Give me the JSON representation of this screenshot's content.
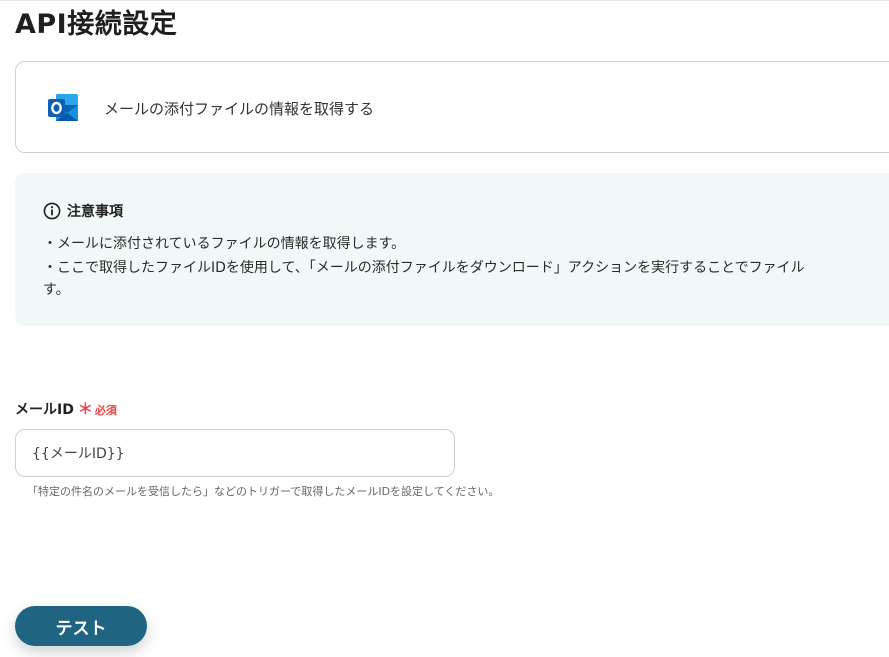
{
  "page": {
    "title": "API接続設定"
  },
  "action": {
    "app_icon": "outlook-icon",
    "label": "メールの添付ファイルの情報を取得する"
  },
  "notice": {
    "icon": "info-icon",
    "title": "注意事項",
    "lines": [
      "・メールに添付されているファイルの情報を取得します。",
      "・ここで取得したファイルIDを使用して、「メールの添付ファイルをダウンロード」アクションを実行することでファイル",
      "す。"
    ]
  },
  "field": {
    "label": "メールID",
    "required_mark": "＊",
    "required_text": "必須",
    "value": "{{メールID}}",
    "hint": "「特定の件名のメールを受信したら」などのトリガーで取得したメールIDを設定してください。"
  },
  "buttons": {
    "test_label": "テスト"
  },
  "colors": {
    "primary_button": "#1f6480",
    "notice_background": "#f0f8f8",
    "required": "#e5484d",
    "outlook_blue": "#0a64ad"
  }
}
